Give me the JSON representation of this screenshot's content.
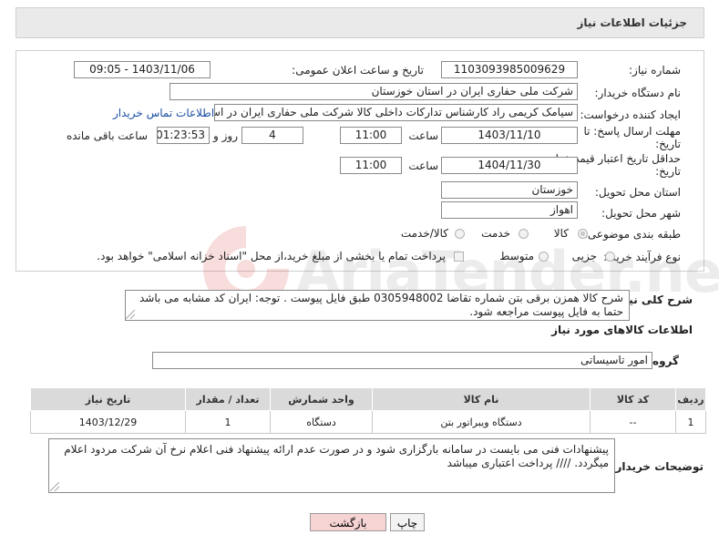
{
  "header": {
    "title": "جزئیات اطلاعات نیاز"
  },
  "form": {
    "need_number": {
      "label": "شماره نیاز:",
      "value": "1103093985009629"
    },
    "announce_datetime": {
      "label": "تاریخ و ساعت اعلان عمومی:",
      "value": "1403/11/06 - 09:05"
    },
    "buyer_org": {
      "label": "نام دستگاه خریدار:",
      "value": "شرکت ملی حفاری ایران در استان خوزستان"
    },
    "requester": {
      "label": "ایجاد کننده درخواست:",
      "value": "سیامک کریمی راد کارشناس تدارکات داخلی کالا شرکت ملی حفاری ایران در استان خوزستان",
      "contact_link": "اطلاعات تماس خریدار"
    },
    "reply_deadline": {
      "label_line1": "مهلت ارسال پاسخ: تا",
      "label_line2": "تاریخ:",
      "date": "1403/11/10",
      "time_label": "ساعت",
      "time": "11:00",
      "days": "4",
      "days_label": "روز و",
      "remaining": "01:23:53",
      "remaining_label": "ساعت باقی مانده"
    },
    "price_validity": {
      "label_line1": "حداقل تاریخ اعتبار قیمت: تا",
      "label_line2": "تاریخ:",
      "date": "1404/11/30",
      "time_label": "ساعت",
      "time": "11:00"
    },
    "delivery_province": {
      "label": "استان محل تحویل:",
      "value": "خوزستان"
    },
    "delivery_city": {
      "label": "شهر محل تحویل:",
      "value": "اهواز"
    },
    "category": {
      "label": "طبقه بندی موضوعی:",
      "options": [
        "کالا",
        "خدمت",
        "کالا/خدمت"
      ],
      "selected": "کالا"
    },
    "process_type": {
      "label": "نوع فرآیند خرید :",
      "options": [
        "جزیی",
        "متوسط"
      ],
      "payment_note": "پرداخت تمام یا بخشی از مبلغ خرید،از محل \"اسناد خزانه اسلامی\" خواهد بود."
    }
  },
  "description": {
    "label": "شرح کلی نیاز:",
    "text": "شرح کالا همزن برقی بتن شماره تقاضا 0305948002 طبق فایل پیوست . توجه: ایران کد مشابه می باشد حتما به فایل پیوست مراجعه شود."
  },
  "goods_section": {
    "title": "اطلاعات کالاهای مورد نیاز",
    "group_label": "گروه کالا:",
    "group_value": "امور تاسیساتی",
    "table": {
      "headers": [
        "ردیف",
        "کد کالا",
        "نام کالا",
        "واحد شمارش",
        "تعداد / مقدار",
        "تاریخ نیاز"
      ],
      "rows": [
        [
          "1",
          "--",
          "دستگاه ویبراتور بتن",
          "دستگاه",
          "1",
          "1403/12/29"
        ]
      ]
    }
  },
  "buyer_notes": {
    "label": "توضیحات خریدار:",
    "text": "پیشنهادات فنی می بایست در سامانه بارگزاری شود و در صورت عدم ارائه پیشنهاد فنی اعلام نرخ آن شرکت مردود اعلام میگردد.  //// پرداخت اعتباری میباشد"
  },
  "buttons": {
    "print": "چاپ",
    "back": "بازگشت"
  },
  "watermark": {
    "text": "AriaTender.neT"
  },
  "colors": {
    "link": "#1a4fa3",
    "back_button_bg": "#f7d4d4",
    "header_bg": "#eaeaea"
  }
}
